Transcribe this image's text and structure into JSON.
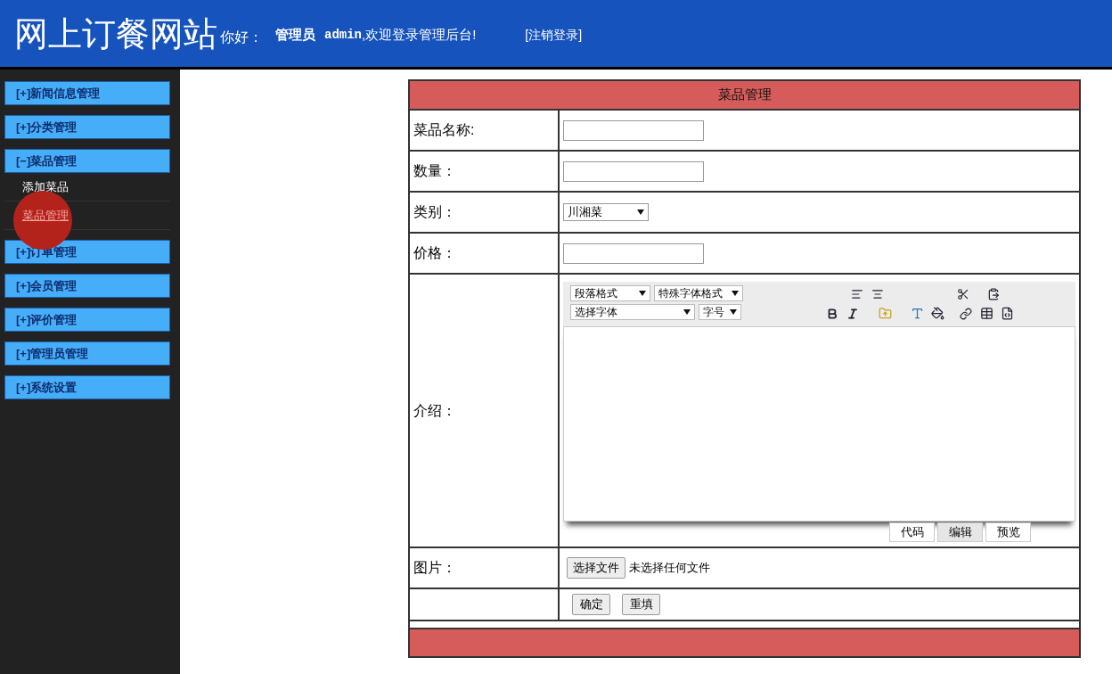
{
  "header": {
    "site_title": "网上订餐网站",
    "greeting": "你好：",
    "role": "管理员",
    "username": "admin",
    "welcome": ",欢迎登录管理后台!",
    "logout": "[注销登录]"
  },
  "sidebar": {
    "groups": [
      {
        "label": "[+]新闻信息管理"
      },
      {
        "label": "[+]分类管理"
      },
      {
        "label": "[−]菜品管理",
        "children": [
          {
            "label": "添加菜品",
            "selected": false
          },
          {
            "label": "菜品管理",
            "selected": true
          }
        ]
      },
      {
        "label": "[+]订单管理"
      },
      {
        "label": "[+]会员管理"
      },
      {
        "label": "[+]评价管理"
      },
      {
        "label": "[+]管理员管理"
      },
      {
        "label": "[+]系统设置"
      }
    ]
  },
  "form": {
    "title": "菜品管理",
    "rows": [
      {
        "kind": "text",
        "label": "菜品名称:"
      },
      {
        "kind": "text",
        "label": "数量："
      },
      {
        "kind": "select",
        "label": "类别：",
        "value": "川湘菜"
      },
      {
        "kind": "text",
        "label": "价格："
      },
      {
        "kind": "editor",
        "label": "介绍：",
        "dropdowns_row1": [
          "段落格式",
          "特殊字体格式"
        ],
        "dropdowns_row2": [
          "选择字体",
          "字号"
        ],
        "modes": [
          {
            "label": "代码",
            "selected": false
          },
          {
            "label": "编辑",
            "selected": true
          },
          {
            "label": "预览",
            "selected": false
          }
        ]
      },
      {
        "kind": "file",
        "label": "图片：",
        "button": "选择文件",
        "status": "未选择任何文件"
      },
      {
        "kind": "actions",
        "label": "",
        "buttons": [
          "确定",
          "重填"
        ]
      }
    ]
  }
}
